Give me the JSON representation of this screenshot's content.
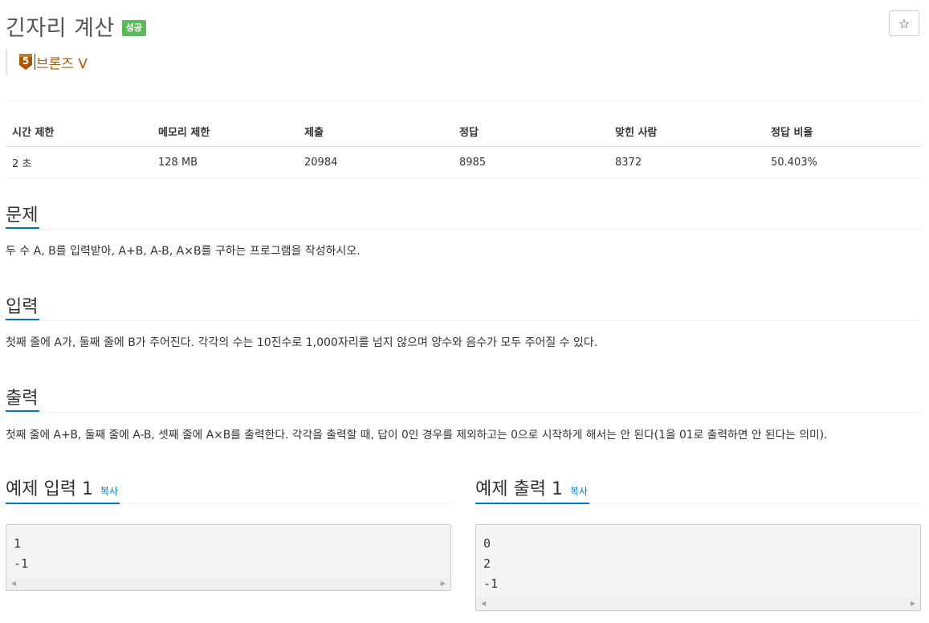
{
  "problem": {
    "title": "긴자리 계산",
    "status_badge": "성공",
    "star_icon": "☆",
    "tier": {
      "level": "5",
      "label": "브론즈 V",
      "color": "#ad5600"
    }
  },
  "info": {
    "headers": [
      "시간 제한",
      "메모리 제한",
      "제출",
      "정답",
      "맞힌 사람",
      "정답 비율"
    ],
    "values": [
      "2 초",
      "128 MB",
      "20984",
      "8985",
      "8372",
      "50.403%"
    ]
  },
  "sections": {
    "description": {
      "title": "문제",
      "body": "두 수 A, B를 입력받아, A+B, A-B, A×B를 구하는 프로그램을 작성하시오."
    },
    "input": {
      "title": "입력",
      "body": "첫째 줄에 A가, 둘째 줄에 B가 주어진다. 각각의 수는 10진수로 1,000자리를 넘지 않으며 양수와 음수가 모두 주어질 수 있다."
    },
    "output": {
      "title": "출력",
      "body": "첫째 줄에 A+B, 둘째 줄에 A-B, 셋째 줄에 A×B를 출력한다. 각각을 출력할 때, 답이 0인 경우를 제외하고는 0으로 시작하게 해서는 안 된다(1을 01로 출력하면 안 된다는 의미)."
    }
  },
  "samples": {
    "input": {
      "title": "예제 입력 1",
      "copy_label": "복사",
      "lines": [
        "1",
        "-1"
      ]
    },
    "output": {
      "title": "예제 출력 1",
      "copy_label": "복사",
      "lines": [
        "0",
        "2",
        "-1"
      ]
    }
  },
  "colors": {
    "accent": "#0076c0",
    "success": "#5cb85c",
    "bronze": "#ad5600"
  }
}
